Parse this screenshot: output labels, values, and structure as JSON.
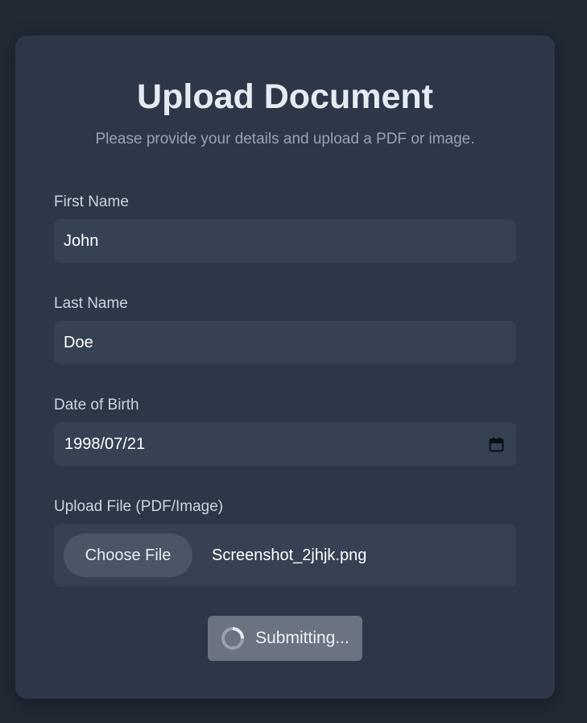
{
  "form": {
    "title": "Upload Document",
    "subtitle": "Please provide your details and upload a PDF or image.",
    "first_name": {
      "label": "First Name",
      "value": "John"
    },
    "last_name": {
      "label": "Last Name",
      "value": "Doe"
    },
    "dob": {
      "label": "Date of Birth",
      "value": "1998/07/21",
      "icon": "calendar-icon"
    },
    "file": {
      "label": "Upload File (PDF/Image)",
      "button_label": "Choose File",
      "file_name": "Screenshot_2jhjk.png"
    },
    "submit": {
      "label": "Submitting...",
      "icon": "spinner-icon"
    }
  },
  "colors": {
    "background": "#222a36",
    "card": "#2e3748",
    "input": "#364153",
    "button_disabled": "#6b7280"
  }
}
